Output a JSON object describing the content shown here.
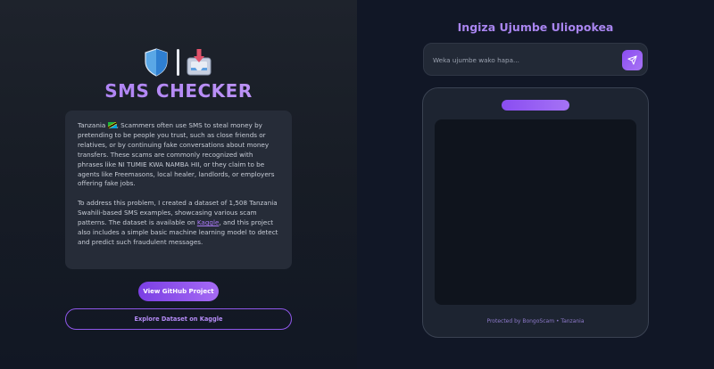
{
  "app": {
    "title": "SMS CHECKER",
    "logo_icons": [
      "shield-icon",
      "inbox-download-icon"
    ]
  },
  "info": {
    "intro_prefix": "Tanzania",
    "flag_icon": "tanzania-flag-icon",
    "intro_text": ", Scammers often use SMS to steal money by pretending to be people you trust, such as close friends or relatives, or by continuing fake conversations about money transfers. These scams are commonly recognized with phrases like NI TUMIE KWA NAMBA HII, or they claim to be agents like Freemasons, local healer, landlords, or employers offering fake jobs.",
    "dataset_text_before": "To address this problem, I created a dataset of 1,508 Tanzania Swahili-based SMS examples, showcasing various scam patterns. The dataset is available on ",
    "dataset_link": "Kaggle",
    "dataset_text_after": ", and this project also includes a simple basic machine learning model to detect and predict such fraudulent messages."
  },
  "buttons": {
    "github": "View GitHub Project",
    "kaggle": "Explore Dataset on Kaggle"
  },
  "checker": {
    "heading": "Ingiza Ujumbe Uliopokea",
    "input_value": "",
    "input_placeholder": "Weka ujumbe wako hapa...",
    "send_icon": "send-icon",
    "footer": "Protected by BongoScam • Tanzania"
  },
  "colors": {
    "accent": "#8b52ef",
    "accent_light": "#a985f0",
    "left_bg": "#1e232c",
    "right_bg": "#111726"
  }
}
